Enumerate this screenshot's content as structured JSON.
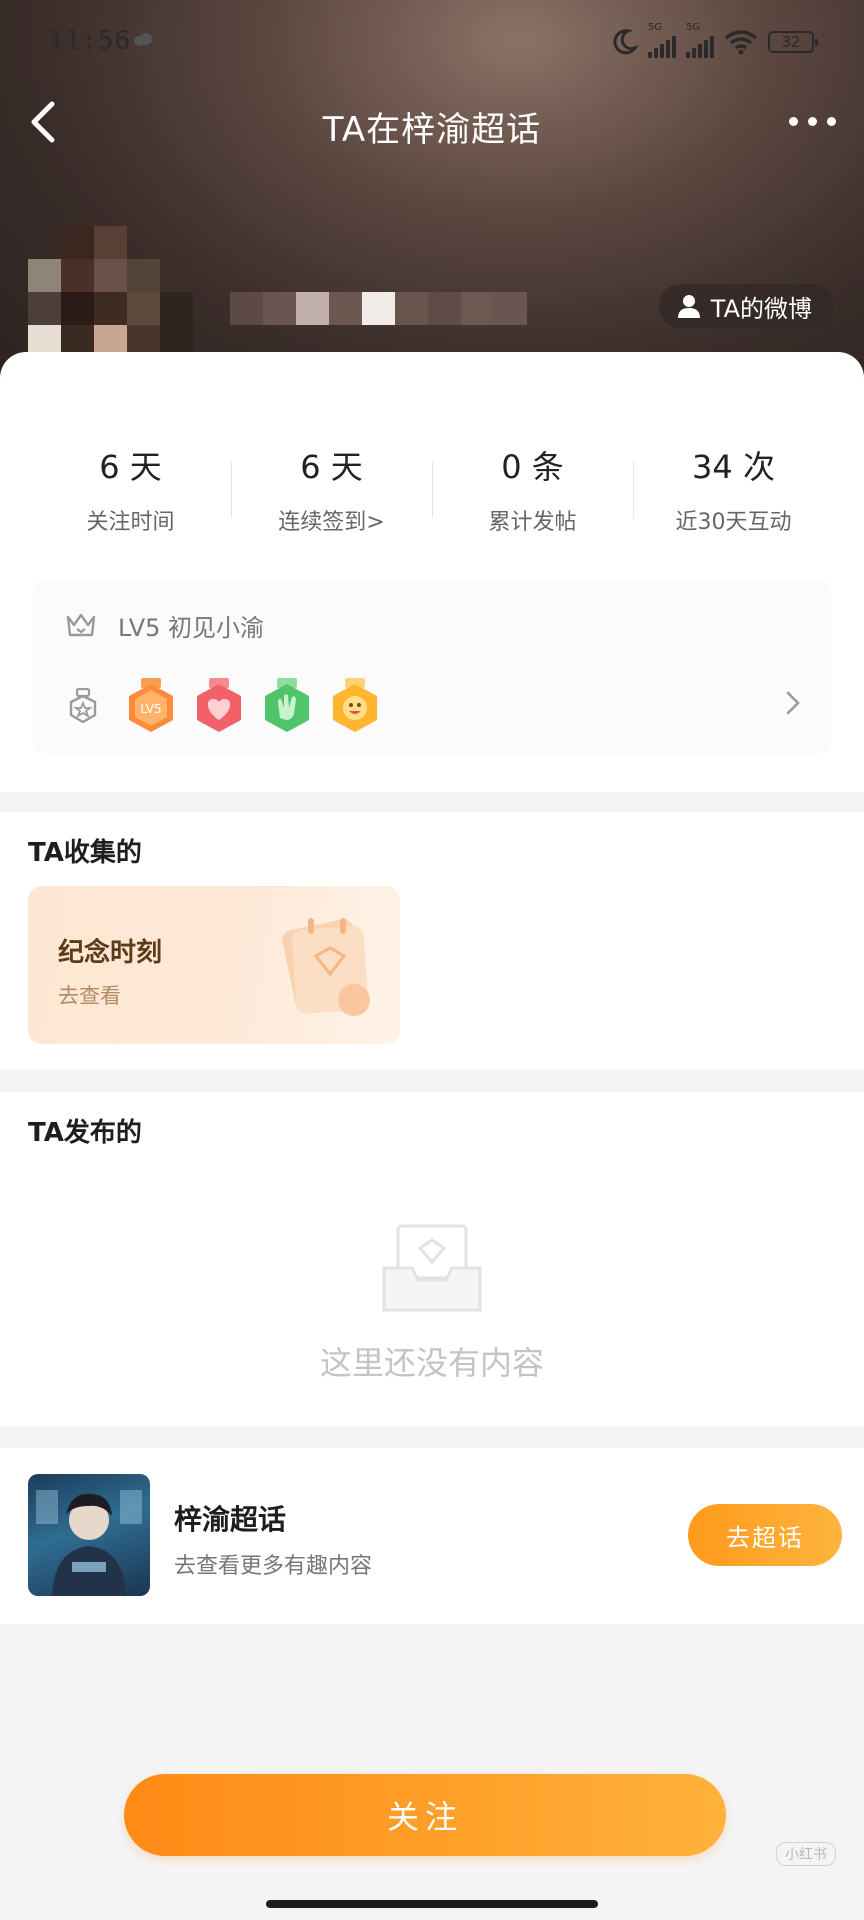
{
  "status_bar": {
    "time": "11:56",
    "network_1": "5G",
    "network_2": "5G",
    "battery": "32"
  },
  "nav": {
    "title": "TA在梓渝超话"
  },
  "profile": {
    "weibo_button_label": "TA的微博"
  },
  "stats": [
    {
      "value": "6 天",
      "label": "关注时间"
    },
    {
      "value": "6 天",
      "label": "连续签到>"
    },
    {
      "value": "0 条",
      "label": "累计发帖"
    },
    {
      "value": "34 次",
      "label": "近30天互动"
    }
  ],
  "level": {
    "text": "LV5 初见小渝",
    "badges": [
      {
        "name": "lv5-badge",
        "color": "#ff8a3c",
        "label": "LV5"
      },
      {
        "name": "heart-badge",
        "color": "#f2606a",
        "label": ""
      },
      {
        "name": "clap-badge",
        "color": "#4fc46a",
        "label": ""
      },
      {
        "name": "emoji-badge",
        "color": "#ffb62e",
        "label": ""
      }
    ]
  },
  "collected": {
    "heading": "TA收集的",
    "card_title": "纪念时刻",
    "card_subtitle": "去查看"
  },
  "posts": {
    "heading": "TA发布的",
    "empty_text": "这里还没有内容"
  },
  "community": {
    "name": "梓渝超话",
    "description": "去查看更多有趣内容",
    "button_label": "去超话"
  },
  "follow_button_label": "关注",
  "watermark": "小红书",
  "colors": {
    "accent_orange": "#ff9a1d",
    "header_dark": "#3a2d2a"
  }
}
